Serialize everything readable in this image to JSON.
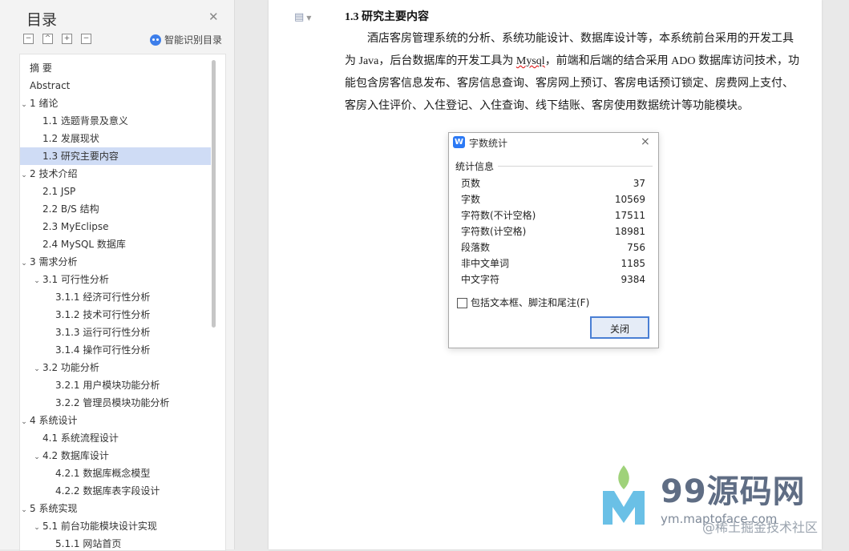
{
  "toc": {
    "title": "目录",
    "toolbar": {
      "collapse": "−",
      "up": "^",
      "add": "+",
      "remove": "−"
    },
    "smart_label": "智能识别目录",
    "items": [
      {
        "label": "摘  要",
        "level": 1,
        "expand": ""
      },
      {
        "label": "Abstract",
        "level": 1,
        "expand": ""
      },
      {
        "label": "1 绪论",
        "level": 1,
        "expand": "expanded"
      },
      {
        "label": "1.1 选题背景及意义",
        "level": 2,
        "expand": ""
      },
      {
        "label": "1.2 发展现状",
        "level": 2,
        "expand": ""
      },
      {
        "label": "1.3 研究主要内容",
        "level": 2,
        "expand": "",
        "selected": true
      },
      {
        "label": "2 技术介绍",
        "level": 1,
        "expand": "expanded"
      },
      {
        "label": "2.1 JSP",
        "level": 2,
        "expand": ""
      },
      {
        "label": "2.2 B/S 结构",
        "level": 2,
        "expand": ""
      },
      {
        "label": "2.3 MyEclipse",
        "level": 2,
        "expand": ""
      },
      {
        "label": "2.4 MySQL 数据库",
        "level": 2,
        "expand": ""
      },
      {
        "label": "3 需求分析",
        "level": 1,
        "expand": "expanded"
      },
      {
        "label": "3.1 可行性分析",
        "level": 2,
        "expand": "expanded"
      },
      {
        "label": "3.1.1  经济可行性分析",
        "level": 3,
        "expand": ""
      },
      {
        "label": "3.1.2  技术可行性分析",
        "level": 3,
        "expand": ""
      },
      {
        "label": "3.1.3  运行可行性分析",
        "level": 3,
        "expand": ""
      },
      {
        "label": "3.1.4  操作可行性分析",
        "level": 3,
        "expand": ""
      },
      {
        "label": "3.2 功能分析",
        "level": 2,
        "expand": "expanded"
      },
      {
        "label": "3.2.1  用户模块功能分析",
        "level": 3,
        "expand": ""
      },
      {
        "label": "3.2.2  管理员模块功能分析",
        "level": 3,
        "expand": ""
      },
      {
        "label": "4 系统设计",
        "level": 1,
        "expand": "expanded"
      },
      {
        "label": "4.1 系统流程设计",
        "level": 2,
        "expand": ""
      },
      {
        "label": "4.2 数据库设计",
        "level": 2,
        "expand": "expanded"
      },
      {
        "label": "4.2.1  数据库概念模型",
        "level": 3,
        "expand": ""
      },
      {
        "label": "4.2.2  数据库表字段设计",
        "level": 3,
        "expand": ""
      },
      {
        "label": "5 系统实现",
        "level": 1,
        "expand": "expanded"
      },
      {
        "label": "5.1  前台功能模块设计实现",
        "level": 2,
        "expand": "expanded"
      },
      {
        "label": "5.1.1 网站首页",
        "level": 3,
        "expand": ""
      }
    ]
  },
  "document": {
    "heading": "1.3 研究主要内容",
    "para_before": "酒店客房管理系统的分析、系统功能设计、数据库设计等，本系统前台采用的开发工具为 Java，后台数据库的开发工具为 ",
    "para_flagged": "Mysql",
    "para_after": "，前端和后端的结合采用 ADO 数据库访问技术，功能包含房客信息发布、客房信息查询、客房网上预订、客房电话预订锁定、房费网上支付、客房入住评价、入住登记、入住查询、线下结账、客房使用数据统计等功能模块。"
  },
  "dialog": {
    "logo": "W",
    "title": "字数统计",
    "close": "×",
    "group_label": "统计信息",
    "stats": [
      {
        "label": "页数",
        "value": "37"
      },
      {
        "label": "字数",
        "value": "10569"
      },
      {
        "label": "字符数(不计空格)",
        "value": "17511"
      },
      {
        "label": "字符数(计空格)",
        "value": "18981"
      },
      {
        "label": "段落数",
        "value": "756"
      },
      {
        "label": "非中文单词",
        "value": "1185"
      },
      {
        "label": "中文字符",
        "value": "9384"
      }
    ],
    "checkbox_label": "包括文本框、脚注和尾注(F)",
    "checkbox_checked": false,
    "close_button": "关闭"
  },
  "watermark": {
    "brand": "99源码网",
    "url": "ym.maptoface.com",
    "credit": "@稀土掘金技术社区"
  }
}
